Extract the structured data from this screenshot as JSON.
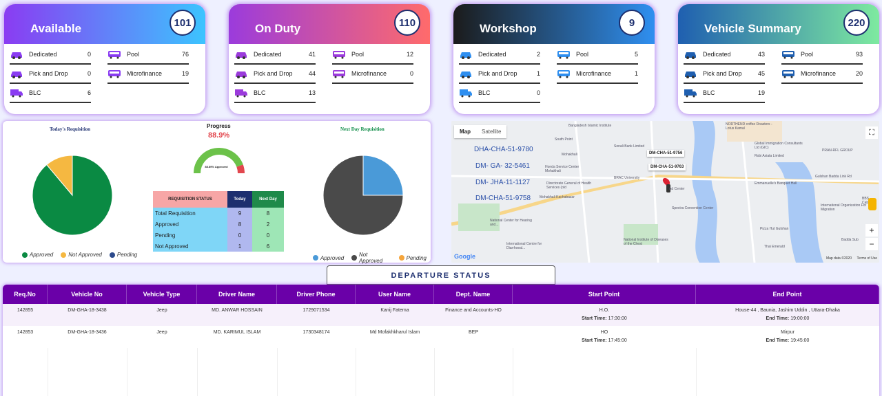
{
  "cards": [
    {
      "title": "Available",
      "count": "101",
      "gradient": [
        "#8a3cf2",
        "#3cc4ff"
      ],
      "rows": [
        {
          "label": "Dedicated",
          "value": "0",
          "icon": "car-icon"
        },
        {
          "label": "Pool",
          "value": "76",
          "icon": "bus-icon"
        },
        {
          "label": "Pick and Drop",
          "value": "0",
          "icon": "car-icon"
        },
        {
          "label": "Microfinance",
          "value": "19",
          "icon": "bus-icon"
        },
        {
          "label": "BLC",
          "value": "6",
          "icon": "truck-icon"
        }
      ]
    },
    {
      "title": "On Duty",
      "count": "110",
      "gradient": [
        "#9b3bdc",
        "#ff6b6b"
      ],
      "rows": [
        {
          "label": "Dedicated",
          "value": "41",
          "icon": "car-icon"
        },
        {
          "label": "Pool",
          "value": "12",
          "icon": "bus-icon"
        },
        {
          "label": "Pick and Drop",
          "value": "44",
          "icon": "car-icon"
        },
        {
          "label": "Microfinance",
          "value": "0",
          "icon": "bus-icon"
        },
        {
          "label": "BLC",
          "value": "13",
          "icon": "truck-icon"
        }
      ]
    },
    {
      "title": "Workshop",
      "count": "9",
      "gradient": [
        "#1b1b1b",
        "#2f8ff0"
      ],
      "rows": [
        {
          "label": "Dedicated",
          "value": "2",
          "icon": "car-icon"
        },
        {
          "label": "Pool",
          "value": "5",
          "icon": "bus-icon"
        },
        {
          "label": "Pick and Drop",
          "value": "1",
          "icon": "car-icon"
        },
        {
          "label": "Microfinance",
          "value": "1",
          "icon": "bus-icon"
        },
        {
          "label": "BLC",
          "value": "0",
          "icon": "truck-icon"
        }
      ]
    },
    {
      "title": "Vehicle Summary",
      "count": "220",
      "gradient": [
        "#1f5fb0",
        "#7eeaa0"
      ],
      "rows": [
        {
          "label": "Dedicated",
          "value": "43",
          "icon": "car-icon"
        },
        {
          "label": "Pool",
          "value": "93",
          "icon": "bus-icon"
        },
        {
          "label": "Pick and Drop",
          "value": "45",
          "icon": "car-icon"
        },
        {
          "label": "Microfinance",
          "value": "20",
          "icon": "bus-icon"
        },
        {
          "label": "BLC",
          "value": "19",
          "icon": "truck-icon"
        }
      ]
    }
  ],
  "todays_requisition": {
    "title": "Today's Requisition",
    "values": {
      "approved": 8,
      "not_approved": 1,
      "pending": 0
    },
    "legend": [
      "Approved",
      "Not Approved",
      "Pending"
    ],
    "colors": [
      "#0a8a43",
      "#f5b841",
      "#2c4a8c"
    ]
  },
  "progress": {
    "title": "Progress",
    "percent_text": "88.9%",
    "value": 88.9,
    "gauge_label": "88.89% Approved"
  },
  "requisition_status": {
    "headers": [
      "REQUISITION STATUS",
      "Today",
      "Next Day"
    ],
    "rows": [
      {
        "label": "Total Requisition",
        "today": "9",
        "next": "8"
      },
      {
        "label": "Approved",
        "today": "8",
        "next": "2"
      },
      {
        "label": "Pending",
        "today": "0",
        "next": "0"
      },
      {
        "label": "Not Approved",
        "today": "1",
        "next": "6"
      }
    ]
  },
  "next_day_requisition": {
    "title": "Next Day Requisition",
    "values": {
      "approved": 2,
      "not_approved": 6,
      "pending": 0
    },
    "legend": [
      "Approved",
      "Not Approved",
      "Pending"
    ],
    "colors": [
      "#4a9ad8",
      "#4a4a4a",
      "#f5a53c"
    ]
  },
  "map": {
    "tabs": [
      "Map",
      "Satellite"
    ],
    "vehicle_labels": [
      "DHA-CHA-51-9780",
      "DM- GA- 32-5461",
      "DM- JHA-11-1127",
      "DM-CHA-51-9758"
    ],
    "popups": [
      "DM-CHA-51-9756",
      "DM-CHA-51-9763"
    ],
    "places": [
      "South Point",
      "Sonali Bank Limited",
      "Honda Service Center Mohakhali",
      "Directorate General of Health Services (old",
      "BRAC University",
      "Global Immigration Consultants Ltd (GIC)",
      "Robi Axiata Limited",
      "Emmanuelle's Banquet Hall",
      "Spectra Convention Center",
      "National Center for Hearing and...",
      "International Centre for Diarrhoeal...",
      "National Institute of Diseases of the Chest",
      "Gulshan Badda Link Rd",
      "PRAN-RFL GROUP",
      "Badda Sub",
      "Thai Emerald",
      "Pizza Hut Gulshan",
      "Mohakhali Kachabazar",
      "Ad Center",
      "NORTHEND coffee Roasters - Lotus Kamal",
      "BBS Cables Lt",
      "International Organization For Migration",
      "Bangladesh Islamic Institute",
      "Mohakhali"
    ],
    "attribution": "Map data ©2020",
    "terms": "Terms of Use"
  },
  "departure": {
    "title": "DEPARTURE STATUS",
    "columns": [
      "Req.No",
      "Vehicle No",
      "Vehicle Type",
      "Driver Name",
      "Driver Phone",
      "User Name",
      "Dept. Name",
      "Start Point",
      "End Point"
    ],
    "rows": [
      {
        "req": "142855",
        "vehicle": "DM-GHA-18-3438",
        "type": "Jeep",
        "driver": "MD. ANWAR HOSSAIN",
        "phone": "1729071534",
        "user": "Kanij Fatema",
        "dept": "Finance and Accounts-HO",
        "start": "H.O.",
        "start_label": "Start Time:",
        "start_time": "17:30:00",
        "end": "House-44 , Baunia, Jashim Uddin , Uttara-Dhaka",
        "end_label": "End Time:",
        "end_time": "19:00:00"
      },
      {
        "req": "142853",
        "vehicle": "DM-GHA-18-3436",
        "type": "Jeep",
        "driver": "MD. KARIMUL ISLAM",
        "phone": "1730348174",
        "user": "Md Mofakhkharul Islam",
        "dept": "BEP",
        "start": "HO",
        "start_label": "Start Time:",
        "start_time": "17:45:00",
        "end": "Mirpur",
        "end_label": "End Time:",
        "end_time": "19:45:00"
      }
    ]
  }
}
